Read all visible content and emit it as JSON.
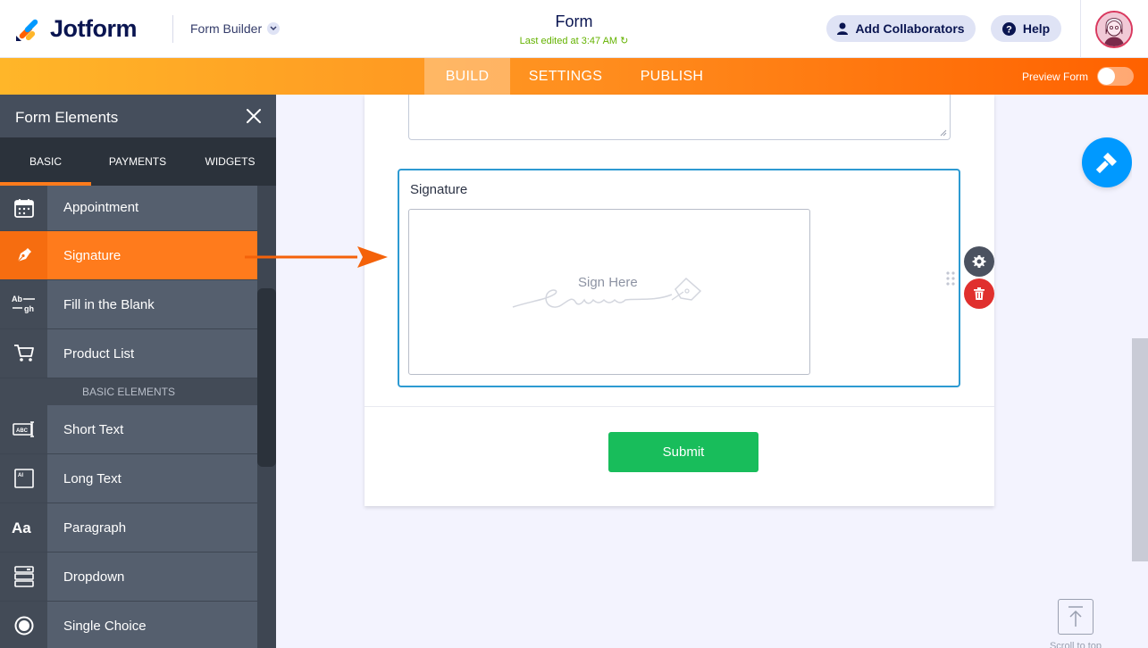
{
  "header": {
    "brand": "Jotform",
    "builder_label": "Form Builder",
    "form_title": "Form",
    "last_edited": "Last edited at 3:47 AM",
    "collab_label": "Add Collaborators",
    "help_label": "Help"
  },
  "nav": {
    "tabs": [
      {
        "label": "BUILD",
        "active": true
      },
      {
        "label": "SETTINGS",
        "active": false
      },
      {
        "label": "PUBLISH",
        "active": false
      }
    ],
    "preview_label": "Preview Form",
    "preview_on": false
  },
  "sidebar": {
    "title": "Form Elements",
    "tabs": [
      {
        "label": "BASIC",
        "active": true
      },
      {
        "label": "PAYMENTS",
        "active": false
      },
      {
        "label": "WIDGETS",
        "active": false
      }
    ],
    "items": [
      {
        "label": "Appointment",
        "icon": "calendar-icon"
      },
      {
        "label": "Signature",
        "icon": "pen-nib-icon",
        "active": true
      },
      {
        "label": "Fill in the Blank",
        "icon": "fill-blank-icon"
      },
      {
        "label": "Product List",
        "icon": "cart-icon"
      }
    ],
    "section_label": "BASIC ELEMENTS",
    "basic_items": [
      {
        "label": "Short Text",
        "icon": "short-text-icon"
      },
      {
        "label": "Long Text",
        "icon": "long-text-icon"
      },
      {
        "label": "Paragraph",
        "icon": "paragraph-icon"
      },
      {
        "label": "Dropdown",
        "icon": "dropdown-icon"
      },
      {
        "label": "Single Choice",
        "icon": "radio-icon"
      }
    ]
  },
  "form": {
    "signature_label": "Signature",
    "sign_placeholder": "Sign Here",
    "submit_label": "Submit"
  },
  "scroll_top_label": "Scroll to top",
  "colors": {
    "accent_orange": "#ff7b1c",
    "selected_border": "#2d9ad2",
    "submit_green": "#18bd5b",
    "delete_red": "#e0302e",
    "fab_blue": "#0099ff"
  }
}
